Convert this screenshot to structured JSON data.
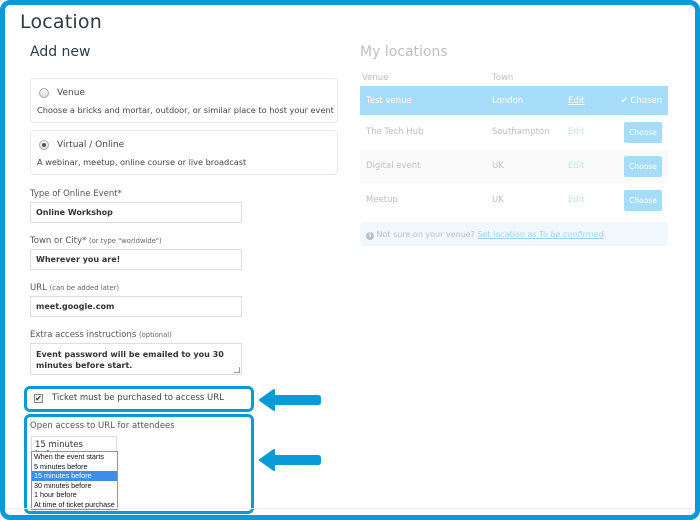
{
  "header": {
    "title": "Location"
  },
  "add_new": {
    "title": "Add new",
    "options": [
      {
        "label": "Venue",
        "description": "Choose a bricks and mortar, outdoor, or similar place to host your event",
        "checked": false
      },
      {
        "label": "Virtual / Online",
        "description": "A webinar, meetup, online course or live broadcast",
        "checked": true
      }
    ],
    "fields": {
      "type": {
        "label": "Type of Online Event*",
        "value": "Online Workshop"
      },
      "town": {
        "label": "Town or City*",
        "hint": "(or type \"worldwide\")",
        "value": "Wherever you are!"
      },
      "url": {
        "label": "URL",
        "hint": "(can be added later)",
        "value": "meet.google.com"
      },
      "extra": {
        "label": "Extra access instructions",
        "hint": "(optional)",
        "value": "Event password will be emailed to you 30 minutes before start."
      }
    },
    "ticket_checkbox": {
      "label": "Ticket must be purchased to access URL",
      "checked": true,
      "glyph": "✔"
    },
    "open_access": {
      "label": "Open access to URL for attendees",
      "selected": "15 minutes before",
      "caret": "▾",
      "options": [
        "When the event starts",
        "5 minutes before",
        "15 minutes before",
        "30 minutes before",
        "1 hour before",
        "At time of ticket purchase"
      ]
    }
  },
  "my_locations": {
    "title": "My locations",
    "columns": [
      "Venue",
      "Town"
    ],
    "rows": [
      {
        "venue": "Test venue",
        "town": "London",
        "edit": "Edit",
        "action": "✔ Chosen",
        "chosen": true
      },
      {
        "venue": "The Tech Hub",
        "town": "Southampton",
        "edit": "Edit",
        "action": "Choose",
        "chosen": false
      },
      {
        "venue": "Digital event",
        "town": "UK",
        "edit": "Edit",
        "action": "Choose",
        "chosen": false
      },
      {
        "venue": "Meetup",
        "town": "UK",
        "edit": "Edit",
        "action": "Choose",
        "chosen": false
      }
    ],
    "info": {
      "icon": "info-icon",
      "text": "Not sure on your venue?",
      "link_prefix": "Set location as",
      "link_italic": "To be confirmed",
      "suffix": "."
    }
  },
  "annotation_color": "#0b9ad8"
}
